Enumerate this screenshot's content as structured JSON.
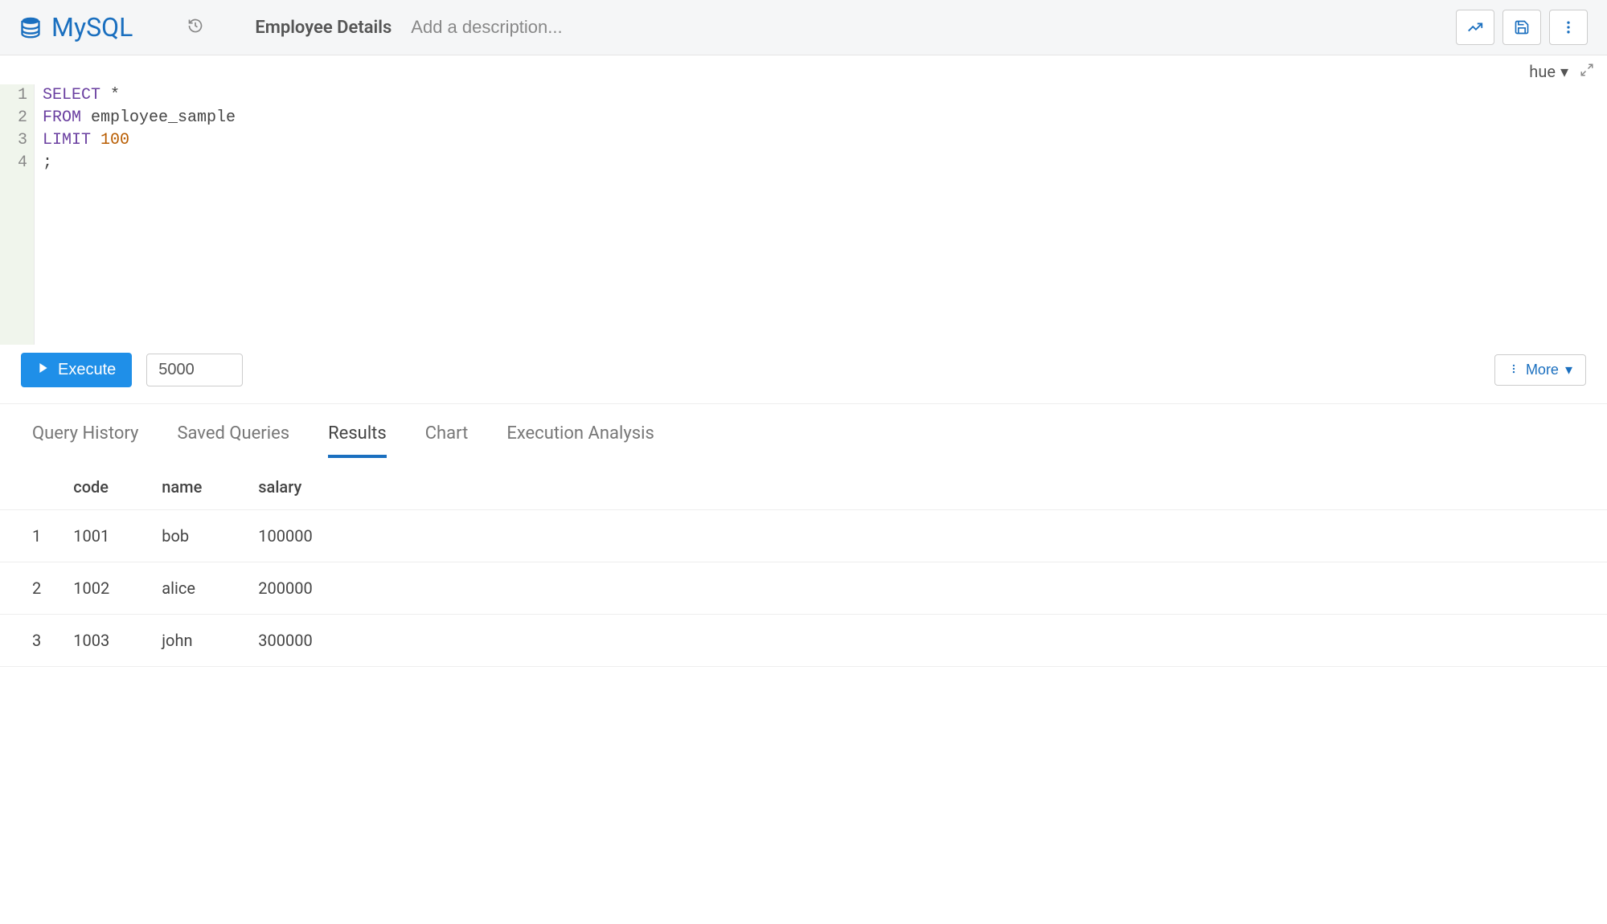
{
  "header": {
    "db_name": "MySQL",
    "title": "Employee Details",
    "description_placeholder": "Add a description...",
    "corner_label": "hue"
  },
  "editor": {
    "lines": [
      {
        "n": "1",
        "tokens": [
          {
            "t": "SELECT",
            "c": "kw"
          },
          {
            "t": " *",
            "c": "ident"
          }
        ]
      },
      {
        "n": "2",
        "tokens": [
          {
            "t": "FROM",
            "c": "kw"
          },
          {
            "t": " employee_sample",
            "c": "ident"
          }
        ]
      },
      {
        "n": "3",
        "tokens": [
          {
            "t": "LIMIT",
            "c": "kw"
          },
          {
            "t": " ",
            "c": "ident"
          },
          {
            "t": "100",
            "c": "num"
          }
        ]
      },
      {
        "n": "4",
        "tokens": [
          {
            "t": ";",
            "c": "ident"
          }
        ]
      }
    ]
  },
  "controls": {
    "execute_label": "Execute",
    "limit_value": "5000",
    "more_label": "More"
  },
  "tabs": [
    {
      "label": "Query History",
      "active": false
    },
    {
      "label": "Saved Queries",
      "active": false
    },
    {
      "label": "Results",
      "active": true
    },
    {
      "label": "Chart",
      "active": false
    },
    {
      "label": "Execution Analysis",
      "active": false
    }
  ],
  "results": {
    "columns": [
      "",
      "code",
      "name",
      "salary"
    ],
    "rows": [
      [
        "1",
        "1001",
        "bob",
        "100000"
      ],
      [
        "2",
        "1002",
        "alice",
        "200000"
      ],
      [
        "3",
        "1003",
        "john",
        "300000"
      ]
    ]
  }
}
